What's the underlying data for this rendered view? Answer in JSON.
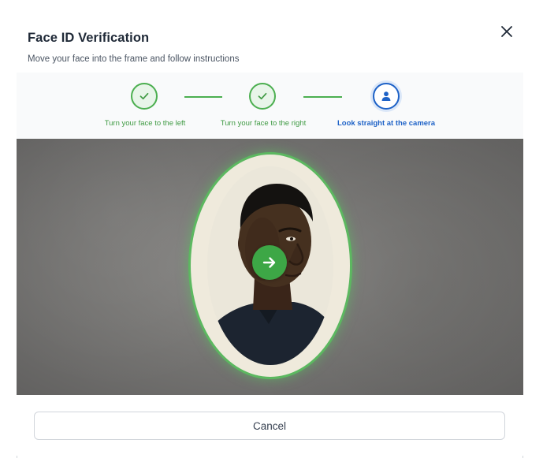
{
  "modal": {
    "title": "Face ID Verification",
    "subtitle": "Move your face into the frame and follow instructions",
    "close_icon": "close-icon"
  },
  "stepper": {
    "steps": [
      {
        "label": "Turn your face to the left",
        "status": "done",
        "icon": "check-icon"
      },
      {
        "label": "Turn your face to the right",
        "status": "done",
        "icon": "check-icon"
      },
      {
        "label": "Look straight at the camera",
        "status": "active",
        "icon": "person-icon"
      }
    ]
  },
  "camera": {
    "direction_icon": "arrow-right-icon"
  },
  "footer": {
    "cancel_label": "Cancel"
  },
  "colors": {
    "success": "#4caf50",
    "active": "#1e62c7",
    "badge": "#3da746"
  }
}
